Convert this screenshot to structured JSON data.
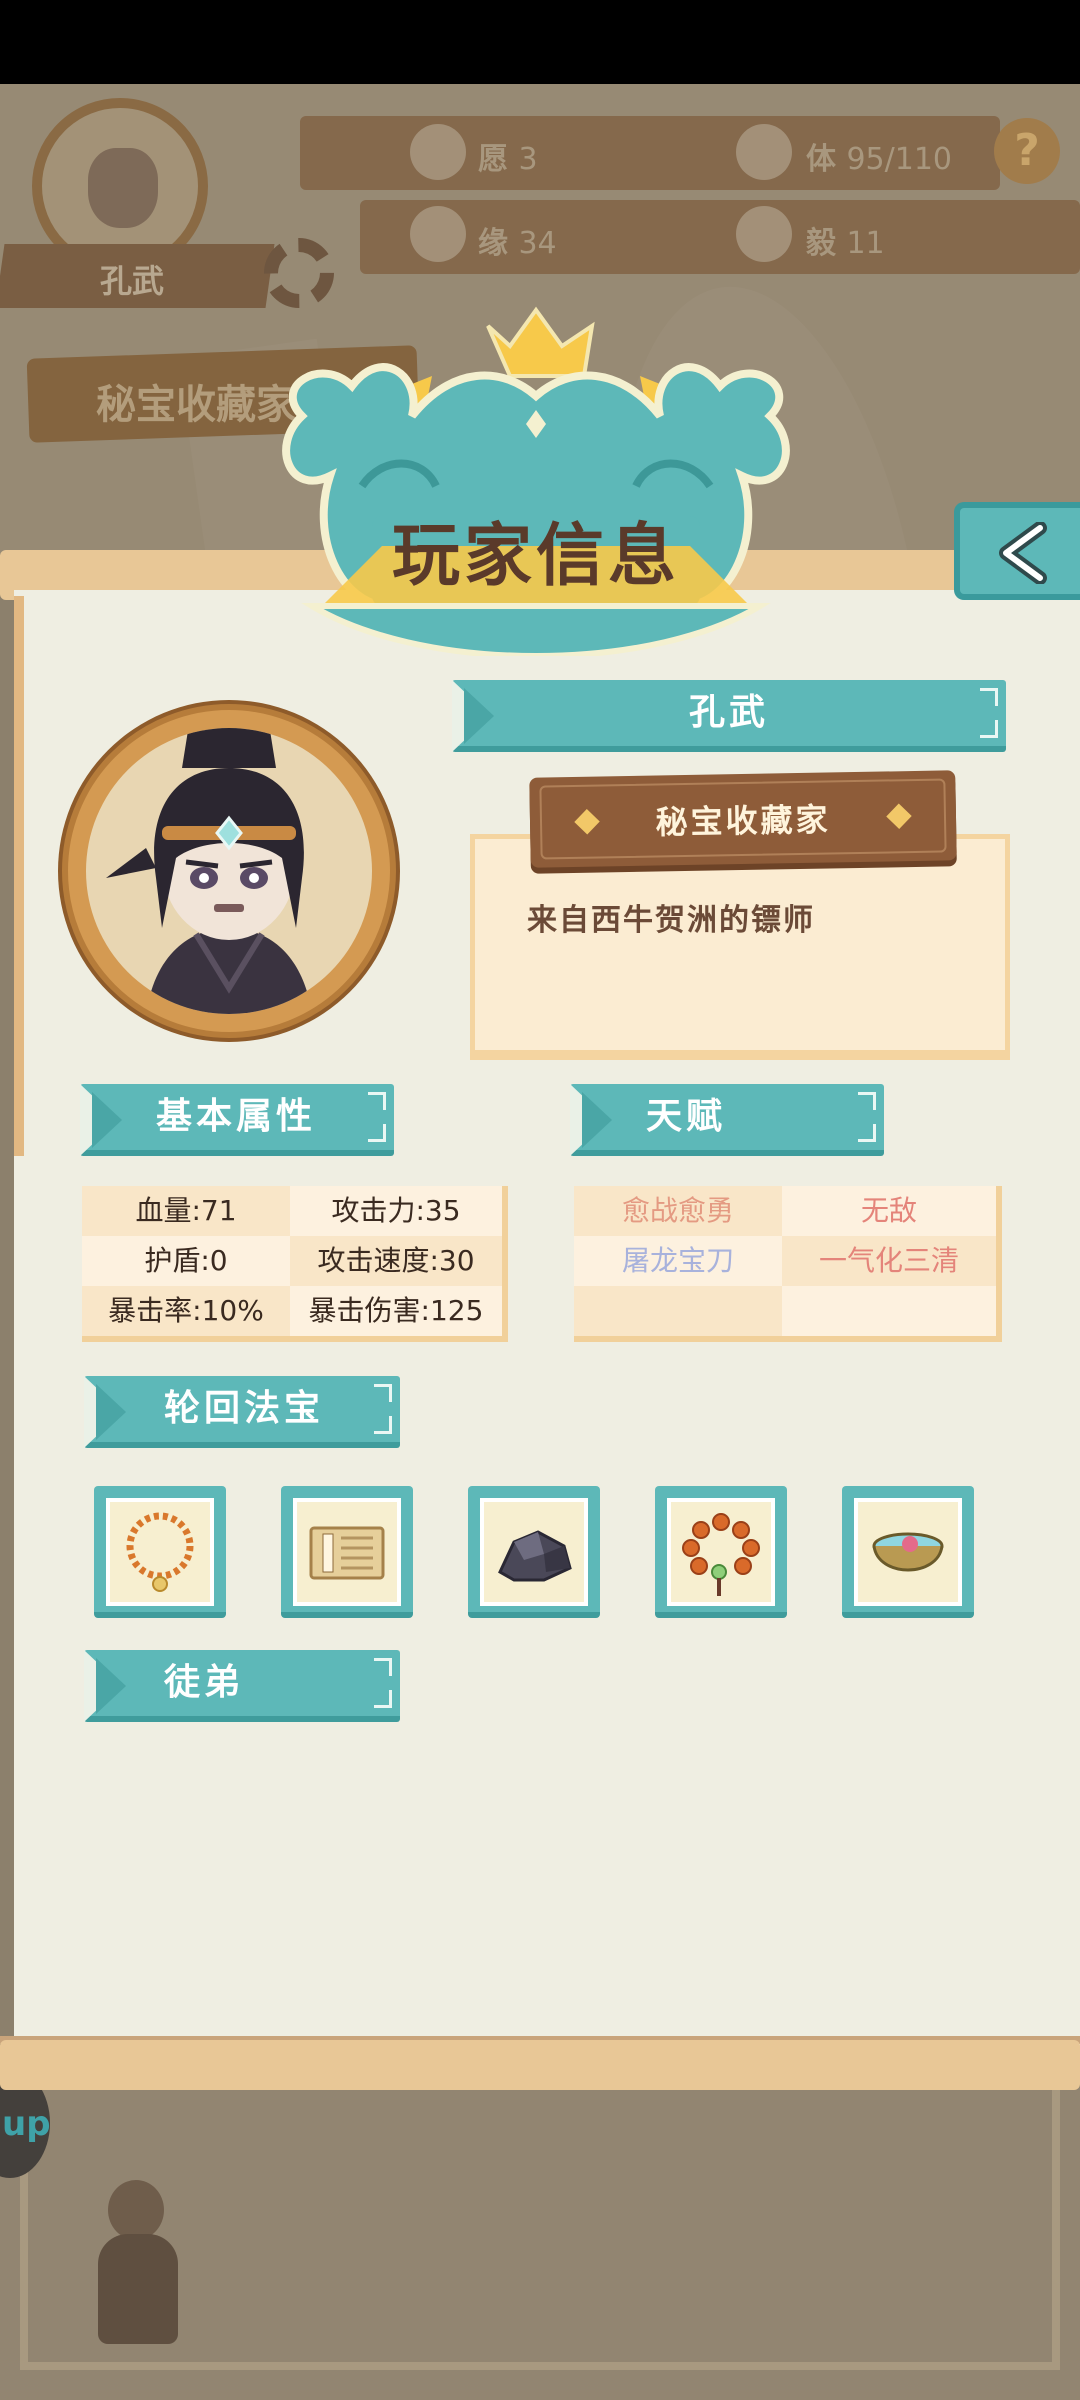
{
  "background": {
    "player_name": "孔武",
    "stats": [
      {
        "icon": "wish-icon",
        "label": "愿",
        "value": "3"
      },
      {
        "icon": "stamina-icon",
        "label": "体",
        "value": "95/110"
      },
      {
        "icon": "lotus-icon",
        "label": "缘",
        "value": "34"
      },
      {
        "icon": "buddha-icon",
        "label": "毅",
        "value": "11"
      }
    ],
    "title": "秘宝收藏家",
    "round_button_label": "up"
  },
  "dialog": {
    "title": "玩家信息",
    "player_name": "孔武",
    "player_title": "秘宝收藏家",
    "description": "来自西牛贺洲的镖师"
  },
  "attributes": {
    "header": "基本属性",
    "rows": [
      [
        "血量:71",
        "攻击力:35"
      ],
      [
        "护盾:0",
        "攻击速度:30"
      ],
      [
        "暴击率:10%",
        "暴击伤害:125"
      ]
    ]
  },
  "talents": {
    "header": "天赋",
    "rows": [
      [
        {
          "name": "愈战愈勇",
          "color": "#e49a82"
        },
        {
          "name": "无敌",
          "color": "#e4847a"
        }
      ],
      [
        {
          "name": "屠龙宝刀",
          "color": "#a8b2dc"
        },
        {
          "name": "一气化三清",
          "color": "#e4847a"
        }
      ],
      [
        {
          "name": "",
          "color": ""
        },
        {
          "name": "",
          "color": ""
        }
      ]
    ]
  },
  "treasures": {
    "header": "轮回法宝",
    "items": [
      {
        "icon": "amber-necklace-icon"
      },
      {
        "icon": "scroll-book-icon"
      },
      {
        "icon": "dark-ore-icon"
      },
      {
        "icon": "prayer-beads-icon"
      },
      {
        "icon": "jade-bowl-icon"
      }
    ]
  },
  "disciples": {
    "header": "徒弟"
  },
  "colors": {
    "teal": "#5db8b8",
    "panel": "#efeee2",
    "wood": "#8e5c39",
    "text_brown": "#5a3a2a"
  }
}
